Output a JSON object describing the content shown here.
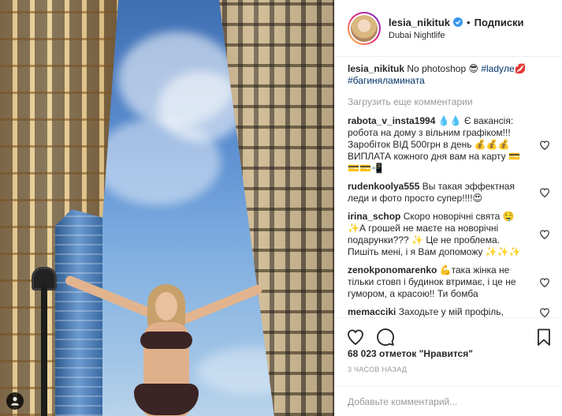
{
  "header": {
    "username": "lesia_nikituk",
    "separator": "•",
    "follow_label": "Подписки",
    "location": "Dubai Nightlife"
  },
  "caption": {
    "username": "lesia_nikituk",
    "text": "No photoshop 😎",
    "hashtag1": "#ladyле💋",
    "hashtag2": "#багиняламината"
  },
  "load_more": "Загрузить еще комментарии",
  "comments": [
    {
      "username": "rabota_v_insta1994",
      "text": "💧💧 Є вакансія: робота на дому з вільним графіком!!! Заробіток ВІД 500грн в день 💰💰💰 ВИПЛАТА кожного дня вам на карту 💳💳💳📲"
    },
    {
      "username": "rudenkoolya555",
      "text": "Вы такая эффектная леди и фото просто супер!!!!😍"
    },
    {
      "username": "irina_schop",
      "text": "Скоро новорічні свята 🤤 ✨А грошей не маєте на новорічні подарунки??? ✨ Це не проблема. Пишіть мені, і я Вам допоможу ✨✨✨"
    },
    {
      "username": "zenokponomarenko",
      "text": "💪така жінка не тільки стовп і будинок втримає, і це не гумором, а красою!! Ти бомба"
    },
    {
      "username": "memacciki",
      "text": "Заходьте у мій профіль,"
    }
  ],
  "likes": "68 023 отметок \"Нравится\"",
  "time_ago": "3 ЧАСОВ НАЗАД",
  "add_comment_placeholder": "Добавьте комментарий...",
  "icons": {
    "like": "heart-icon",
    "comment": "comment-icon",
    "save": "bookmark-icon",
    "verified": "verified-badge-icon",
    "tag": "person-tag-icon"
  },
  "colors": {
    "text": "#262626",
    "muted": "#999999",
    "link": "#003569",
    "verified": "#3897f0",
    "border": "#efefef"
  }
}
